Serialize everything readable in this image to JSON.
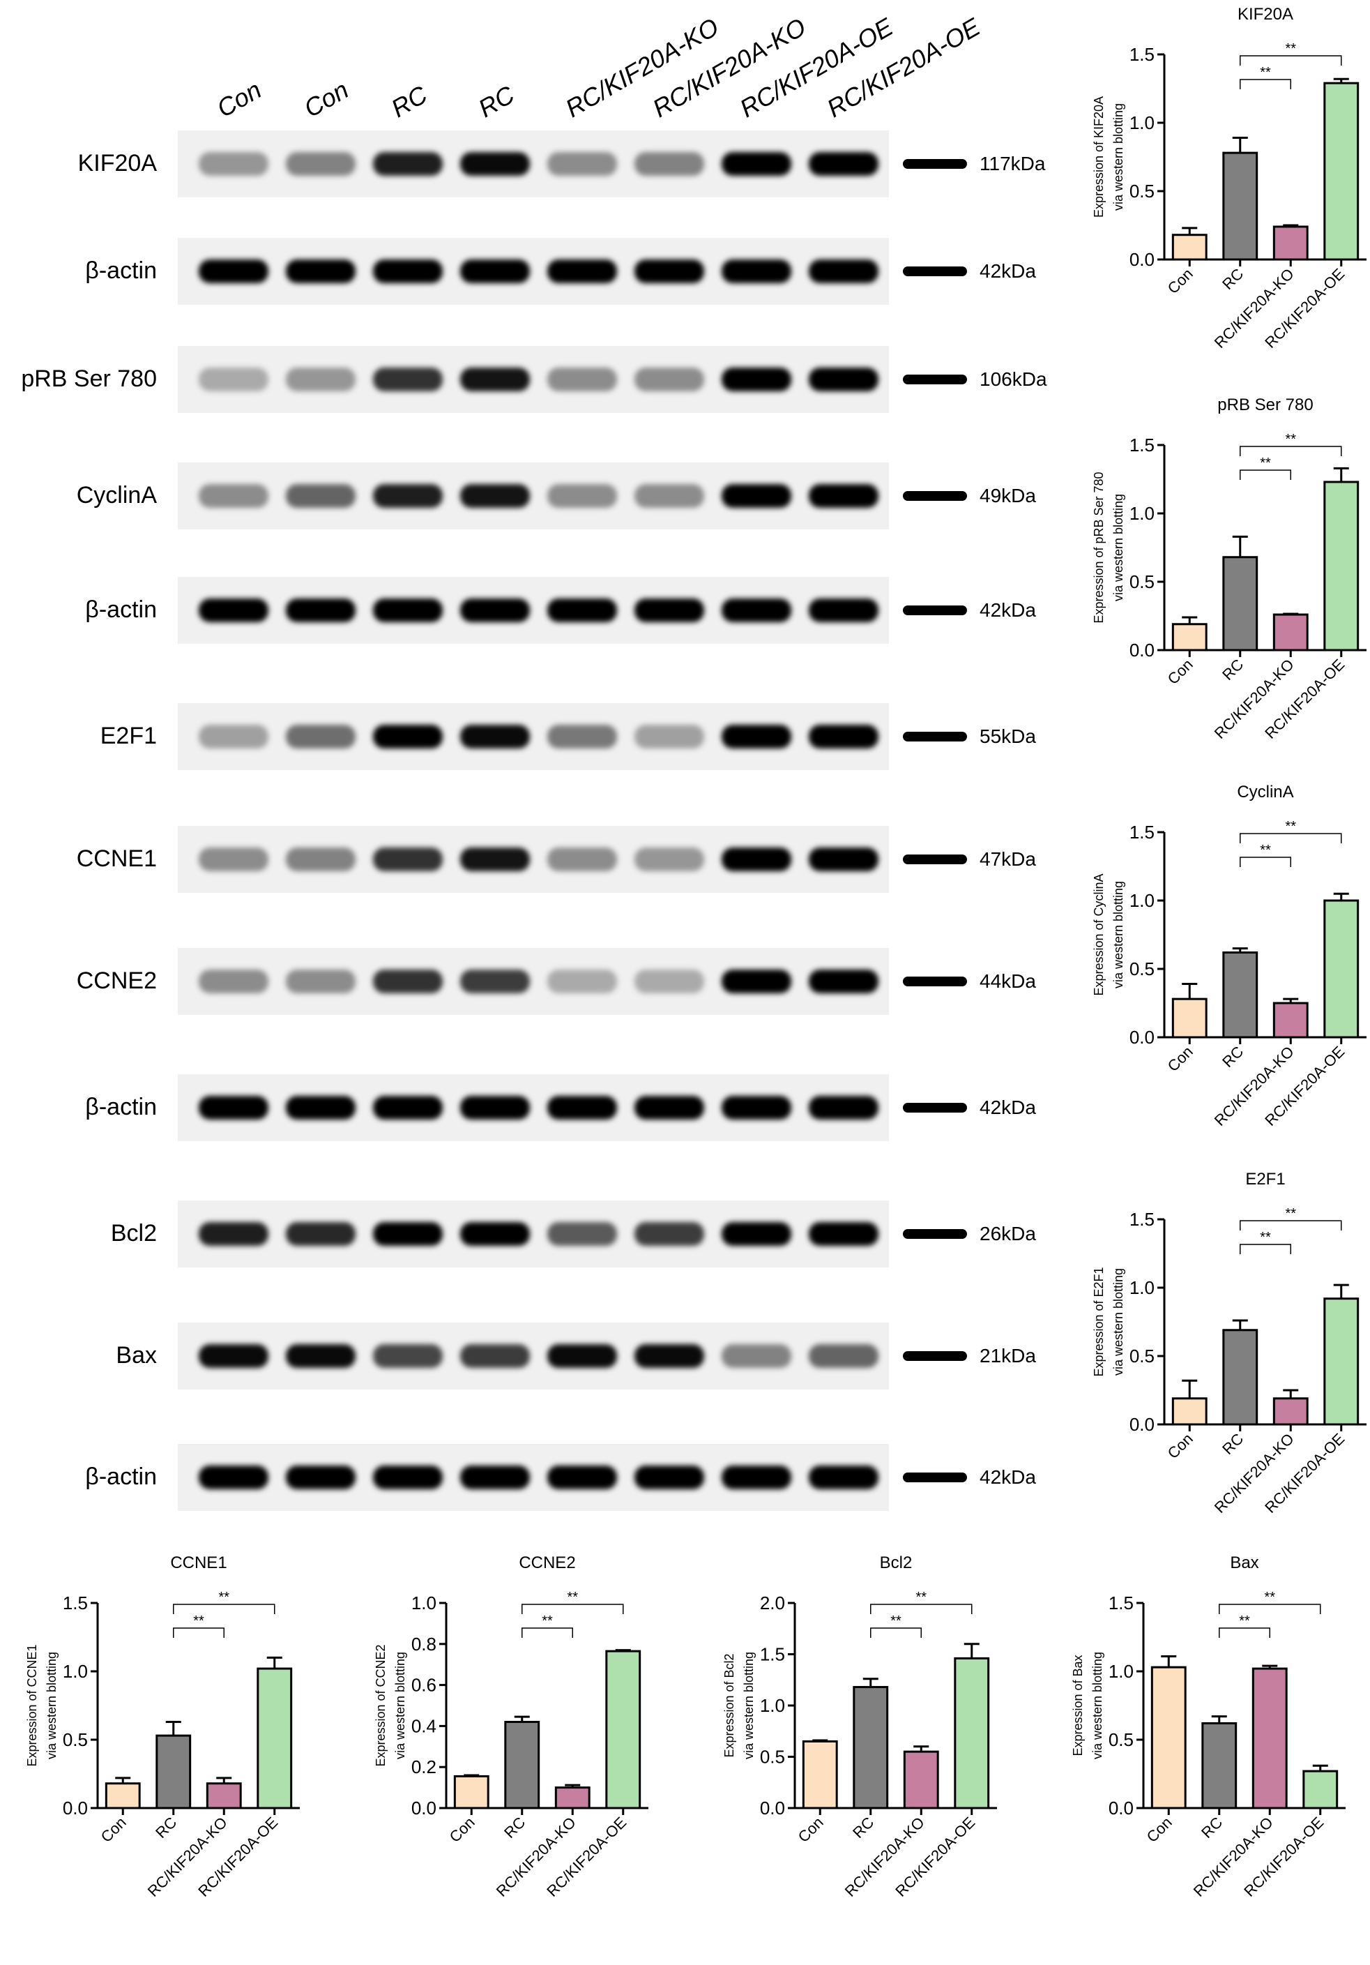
{
  "lanes": [
    "Con",
    "Con",
    "RC",
    "RC",
    "RC/KIF20A-KO",
    "RC/KIF20A-KO",
    "RC/KIF20A-OE",
    "RC/KIF20A-OE"
  ],
  "blots": [
    {
      "label": "KIF20A",
      "kda": "117kDa",
      "intensity": [
        0.25,
        0.35,
        0.85,
        0.95,
        0.3,
        0.35,
        1.0,
        1.0
      ]
    },
    {
      "label": "β-actin",
      "kda": "42kDa",
      "intensity": [
        1,
        1,
        1,
        1,
        1,
        1,
        1,
        1
      ]
    },
    {
      "label": "pRB Ser 780",
      "kda": "106kDa",
      "intensity": [
        0.15,
        0.25,
        0.75,
        0.9,
        0.3,
        0.3,
        1.0,
        1.0
      ]
    },
    {
      "label": "CyclinA",
      "kda": "49kDa",
      "intensity": [
        0.3,
        0.5,
        0.85,
        0.9,
        0.3,
        0.3,
        1.0,
        1.0
      ]
    },
    {
      "label": "β-actin",
      "kda": "42kDa",
      "intensity": [
        1,
        1,
        1,
        1,
        1,
        1,
        1,
        1
      ]
    },
    {
      "label": "E2F1",
      "kda": "55kDa",
      "intensity": [
        0.2,
        0.45,
        1.0,
        0.95,
        0.4,
        0.2,
        1.0,
        1.0
      ]
    },
    {
      "label": "CCNE1",
      "kda": "47kDa",
      "intensity": [
        0.3,
        0.35,
        0.75,
        0.9,
        0.3,
        0.25,
        1.0,
        1.0
      ]
    },
    {
      "label": "CCNE2",
      "kda": "44kDa",
      "intensity": [
        0.3,
        0.3,
        0.75,
        0.7,
        0.15,
        0.15,
        1.0,
        1.0
      ]
    },
    {
      "label": "β-actin",
      "kda": "42kDa",
      "intensity": [
        1,
        1,
        1,
        1,
        1,
        1,
        1,
        1
      ]
    },
    {
      "label": "Bcl2",
      "kda": "26kDa",
      "intensity": [
        0.85,
        0.8,
        1.0,
        1.0,
        0.55,
        0.7,
        1.0,
        1.0
      ]
    },
    {
      "label": "Bax",
      "kda": "21kDa",
      "intensity": [
        0.95,
        0.95,
        0.65,
        0.7,
        0.95,
        0.95,
        0.35,
        0.5
      ]
    },
    {
      "label": "β-actin",
      "kda": "42kDa",
      "intensity": [
        1,
        1,
        1,
        1,
        1,
        1,
        1,
        1
      ]
    }
  ],
  "colors": {
    "Con": "#fde0c0",
    "RC": "#808080",
    "RC/KIF20A-KO": "#c77fa0",
    "RC/KIF20A-OE": "#aee0ae"
  },
  "chart_data": [
    {
      "type": "bar",
      "title": "KIF20A",
      "ylabel": "Expression of KIF20A via western blotting",
      "ylim": [
        0,
        1.5
      ],
      "yticks": [
        0.0,
        0.5,
        1.0,
        1.5
      ],
      "categories": [
        "Con",
        "RC",
        "RC/KIF20A-KO",
        "RC/KIF20A-OE"
      ],
      "values": [
        0.18,
        0.78,
        0.24,
        1.29
      ],
      "errors": [
        0.05,
        0.11,
        0.01,
        0.03
      ],
      "significance": [
        {
          "from": "RC",
          "to": "RC/KIF20A-KO",
          "label": "**"
        },
        {
          "from": "RC",
          "to": "RC/KIF20A-OE",
          "label": "**"
        }
      ]
    },
    {
      "type": "bar",
      "title": "pRB Ser 780",
      "ylabel": "Expression of pRB Ser 780 via western blotting",
      "ylim": [
        0,
        1.5
      ],
      "yticks": [
        0.0,
        0.5,
        1.0,
        1.5
      ],
      "categories": [
        "Con",
        "RC",
        "RC/KIF20A-KO",
        "RC/KIF20A-OE"
      ],
      "values": [
        0.19,
        0.68,
        0.26,
        1.23
      ],
      "errors": [
        0.05,
        0.15,
        0.005,
        0.1
      ],
      "significance": [
        {
          "from": "RC",
          "to": "RC/KIF20A-KO",
          "label": "**"
        },
        {
          "from": "RC",
          "to": "RC/KIF20A-OE",
          "label": "**"
        }
      ]
    },
    {
      "type": "bar",
      "title": "CyclinA",
      "ylabel": "Expression of CyclinA via western blotting",
      "ylim": [
        0,
        1.5
      ],
      "yticks": [
        0.0,
        0.5,
        1.0,
        1.5
      ],
      "categories": [
        "Con",
        "RC",
        "RC/KIF20A-KO",
        "RC/KIF20A-OE"
      ],
      "values": [
        0.28,
        0.62,
        0.25,
        1.0
      ],
      "errors": [
        0.11,
        0.03,
        0.03,
        0.05
      ],
      "significance": [
        {
          "from": "RC",
          "to": "RC/KIF20A-KO",
          "label": "**"
        },
        {
          "from": "RC",
          "to": "RC/KIF20A-OE",
          "label": "**"
        }
      ]
    },
    {
      "type": "bar",
      "title": "E2F1",
      "ylabel": "Expression of E2F1 via western blotting",
      "ylim": [
        0,
        1.5
      ],
      "yticks": [
        0.0,
        0.5,
        1.0,
        1.5
      ],
      "categories": [
        "Con",
        "RC",
        "RC/KIF20A-KO",
        "RC/KIF20A-OE"
      ],
      "values": [
        0.19,
        0.69,
        0.19,
        0.92
      ],
      "errors": [
        0.13,
        0.07,
        0.06,
        0.1
      ],
      "significance": [
        {
          "from": "RC",
          "to": "RC/KIF20A-KO",
          "label": "**"
        },
        {
          "from": "RC",
          "to": "RC/KIF20A-OE",
          "label": "**"
        }
      ]
    },
    {
      "type": "bar",
      "title": "CCNE1",
      "ylabel": "Expression of CCNE1 via western blotting",
      "ylim": [
        0,
        1.5
      ],
      "yticks": [
        0.0,
        0.5,
        1.0,
        1.5
      ],
      "categories": [
        "Con",
        "RC",
        "RC/KIF20A-KO",
        "RC/KIF20A-OE"
      ],
      "values": [
        0.18,
        0.53,
        0.18,
        1.02
      ],
      "errors": [
        0.04,
        0.1,
        0.04,
        0.08
      ],
      "significance": [
        {
          "from": "RC",
          "to": "RC/KIF20A-KO",
          "label": "**"
        },
        {
          "from": "RC",
          "to": "RC/KIF20A-OE",
          "label": "**"
        }
      ]
    },
    {
      "type": "bar",
      "title": "CCNE2",
      "ylabel": "Expression of CCNE2 via western blotting",
      "ylim": [
        0,
        1.0
      ],
      "yticks": [
        0.0,
        0.2,
        0.4,
        0.6,
        0.8,
        1.0
      ],
      "categories": [
        "Con",
        "RC",
        "RC/KIF20A-KO",
        "RC/KIF20A-OE"
      ],
      "values": [
        0.155,
        0.42,
        0.1,
        0.765
      ],
      "errors": [
        0.005,
        0.025,
        0.012,
        0.005
      ],
      "significance": [
        {
          "from": "RC",
          "to": "RC/KIF20A-KO",
          "label": "**"
        },
        {
          "from": "RC",
          "to": "RC/KIF20A-OE",
          "label": "**"
        }
      ]
    },
    {
      "type": "bar",
      "title": "Bcl2",
      "ylabel": "Expression of Bcl2 via western blotting",
      "ylim": [
        0,
        2.0
      ],
      "yticks": [
        0.0,
        0.5,
        1.0,
        1.5,
        2.0
      ],
      "categories": [
        "Con",
        "RC",
        "RC/KIF20A-KO",
        "RC/KIF20A-OE"
      ],
      "values": [
        0.65,
        1.18,
        0.55,
        1.46
      ],
      "errors": [
        0.01,
        0.08,
        0.05,
        0.14
      ],
      "significance": [
        {
          "from": "RC",
          "to": "RC/KIF20A-KO",
          "label": "**"
        },
        {
          "from": "RC",
          "to": "RC/KIF20A-OE",
          "label": "**"
        }
      ]
    },
    {
      "type": "bar",
      "title": "Bax",
      "ylabel": "Expression of Bax via western blotting",
      "ylim": [
        0,
        1.5
      ],
      "yticks": [
        0.0,
        0.5,
        1.0,
        1.5
      ],
      "categories": [
        "Con",
        "RC",
        "RC/KIF20A-KO",
        "RC/KIF20A-OE"
      ],
      "values": [
        1.03,
        0.62,
        1.02,
        0.27
      ],
      "errors": [
        0.08,
        0.05,
        0.02,
        0.04
      ],
      "significance": [
        {
          "from": "RC",
          "to": "RC/KIF20A-KO",
          "label": "**"
        },
        {
          "from": "RC",
          "to": "RC/KIF20A-OE",
          "label": "**"
        }
      ]
    }
  ]
}
